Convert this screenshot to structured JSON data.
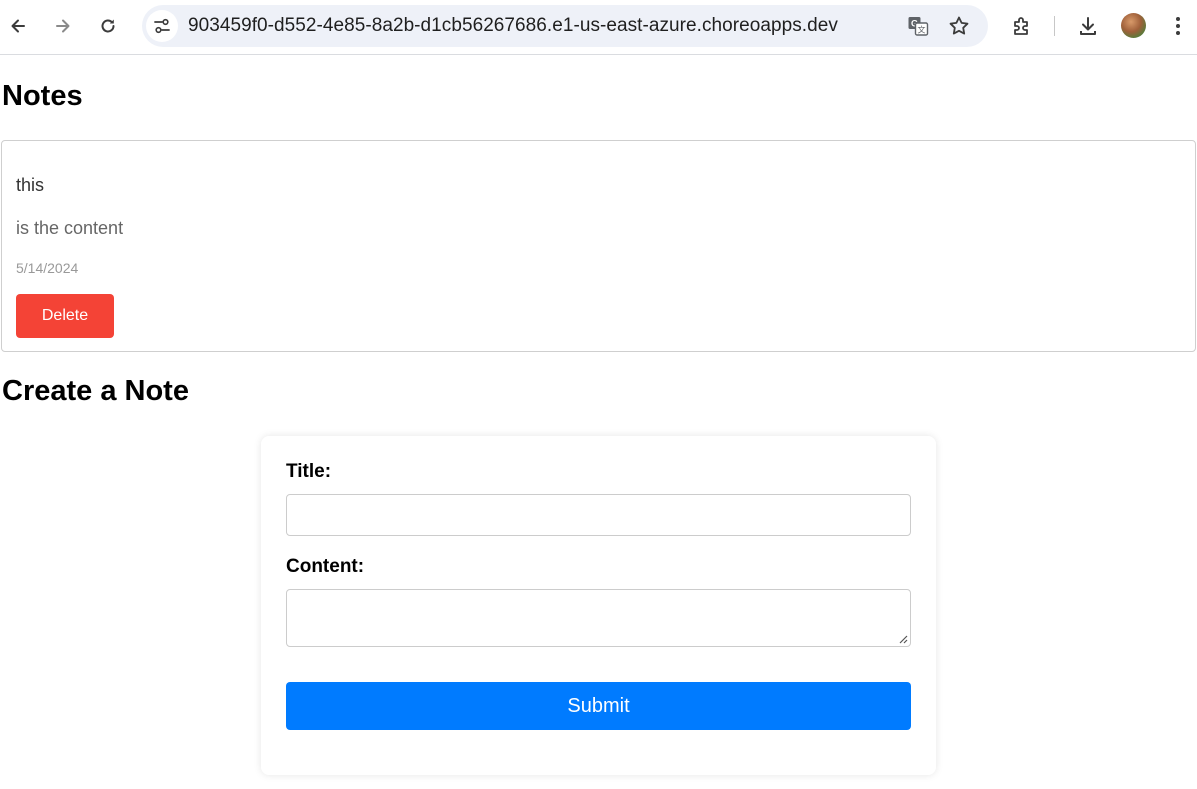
{
  "browser": {
    "url": "903459f0-d552-4e85-8a2b-d1cb56267686.e1-us-east-azure.choreoapps.dev",
    "icons": [
      "back-arrow-icon",
      "forward-arrow-icon",
      "reload-icon",
      "site-info-icon",
      "translate-icon",
      "bookmark-star-icon",
      "extensions-icon",
      "download-icon",
      "profile-avatar",
      "more-menu-icon"
    ]
  },
  "notes": {
    "heading": "Notes",
    "items": [
      {
        "title": "this",
        "content": "is the content",
        "date": "5/14/2024",
        "delete_label": "Delete"
      }
    ]
  },
  "create": {
    "heading": "Create a Note",
    "title_label": "Title:",
    "title_value": "",
    "content_label": "Content:",
    "content_value": "",
    "submit_label": "Submit"
  },
  "colors": {
    "delete": "#f44336",
    "submit": "#007bff",
    "omnibox": "#eef1f8"
  }
}
